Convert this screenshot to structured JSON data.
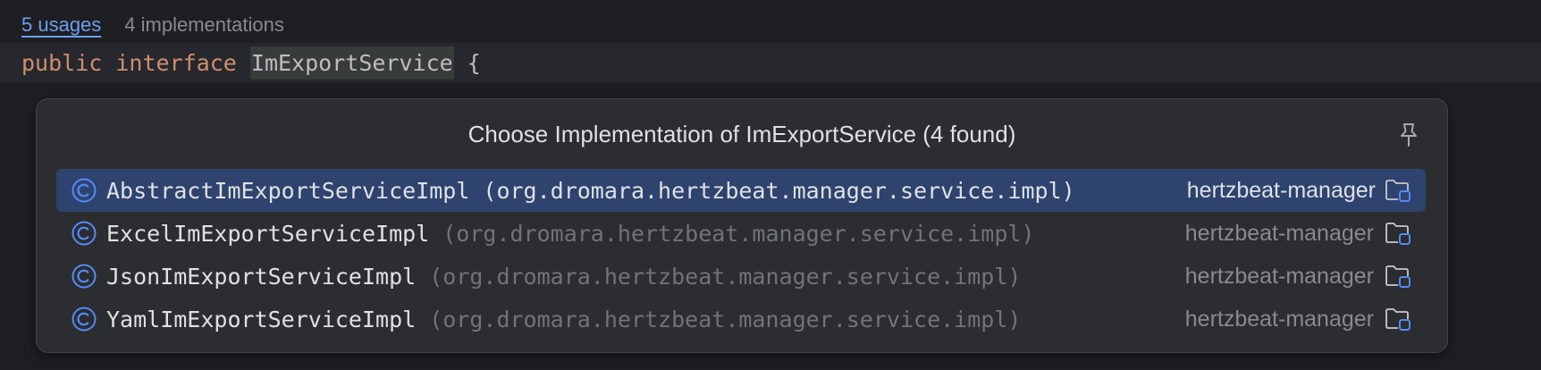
{
  "inlay": {
    "usages": "5 usages",
    "implementations": "4 implementations"
  },
  "code": {
    "kw_public": "public",
    "kw_interface": "interface",
    "identifier": "ImExportService",
    "brace": "{"
  },
  "popup": {
    "title": "Choose Implementation of ImExportService (4 found)",
    "pin_icon": "pin-icon",
    "items": [
      {
        "class_name": "AbstractImExportServiceImpl",
        "package": "(org.dromara.hertzbeat.manager.service.impl)",
        "module": "hertzbeat-manager",
        "selected": true
      },
      {
        "class_name": "ExcelImExportServiceImpl",
        "package": "(org.dromara.hertzbeat.manager.service.impl)",
        "module": "hertzbeat-manager",
        "selected": false
      },
      {
        "class_name": "JsonImExportServiceImpl",
        "package": "(org.dromara.hertzbeat.manager.service.impl)",
        "module": "hertzbeat-manager",
        "selected": false
      },
      {
        "class_name": "YamlImExportServiceImpl",
        "package": "(org.dromara.hertzbeat.manager.service.impl)",
        "module": "hertzbeat-manager",
        "selected": false
      }
    ]
  },
  "colors": {
    "background": "#1e1f22",
    "popup_bg": "#2b2d30",
    "selection": "#2e436e",
    "keyword": "#cf8e6d",
    "link": "#6d9ef0",
    "class_icon": "#548af7"
  }
}
